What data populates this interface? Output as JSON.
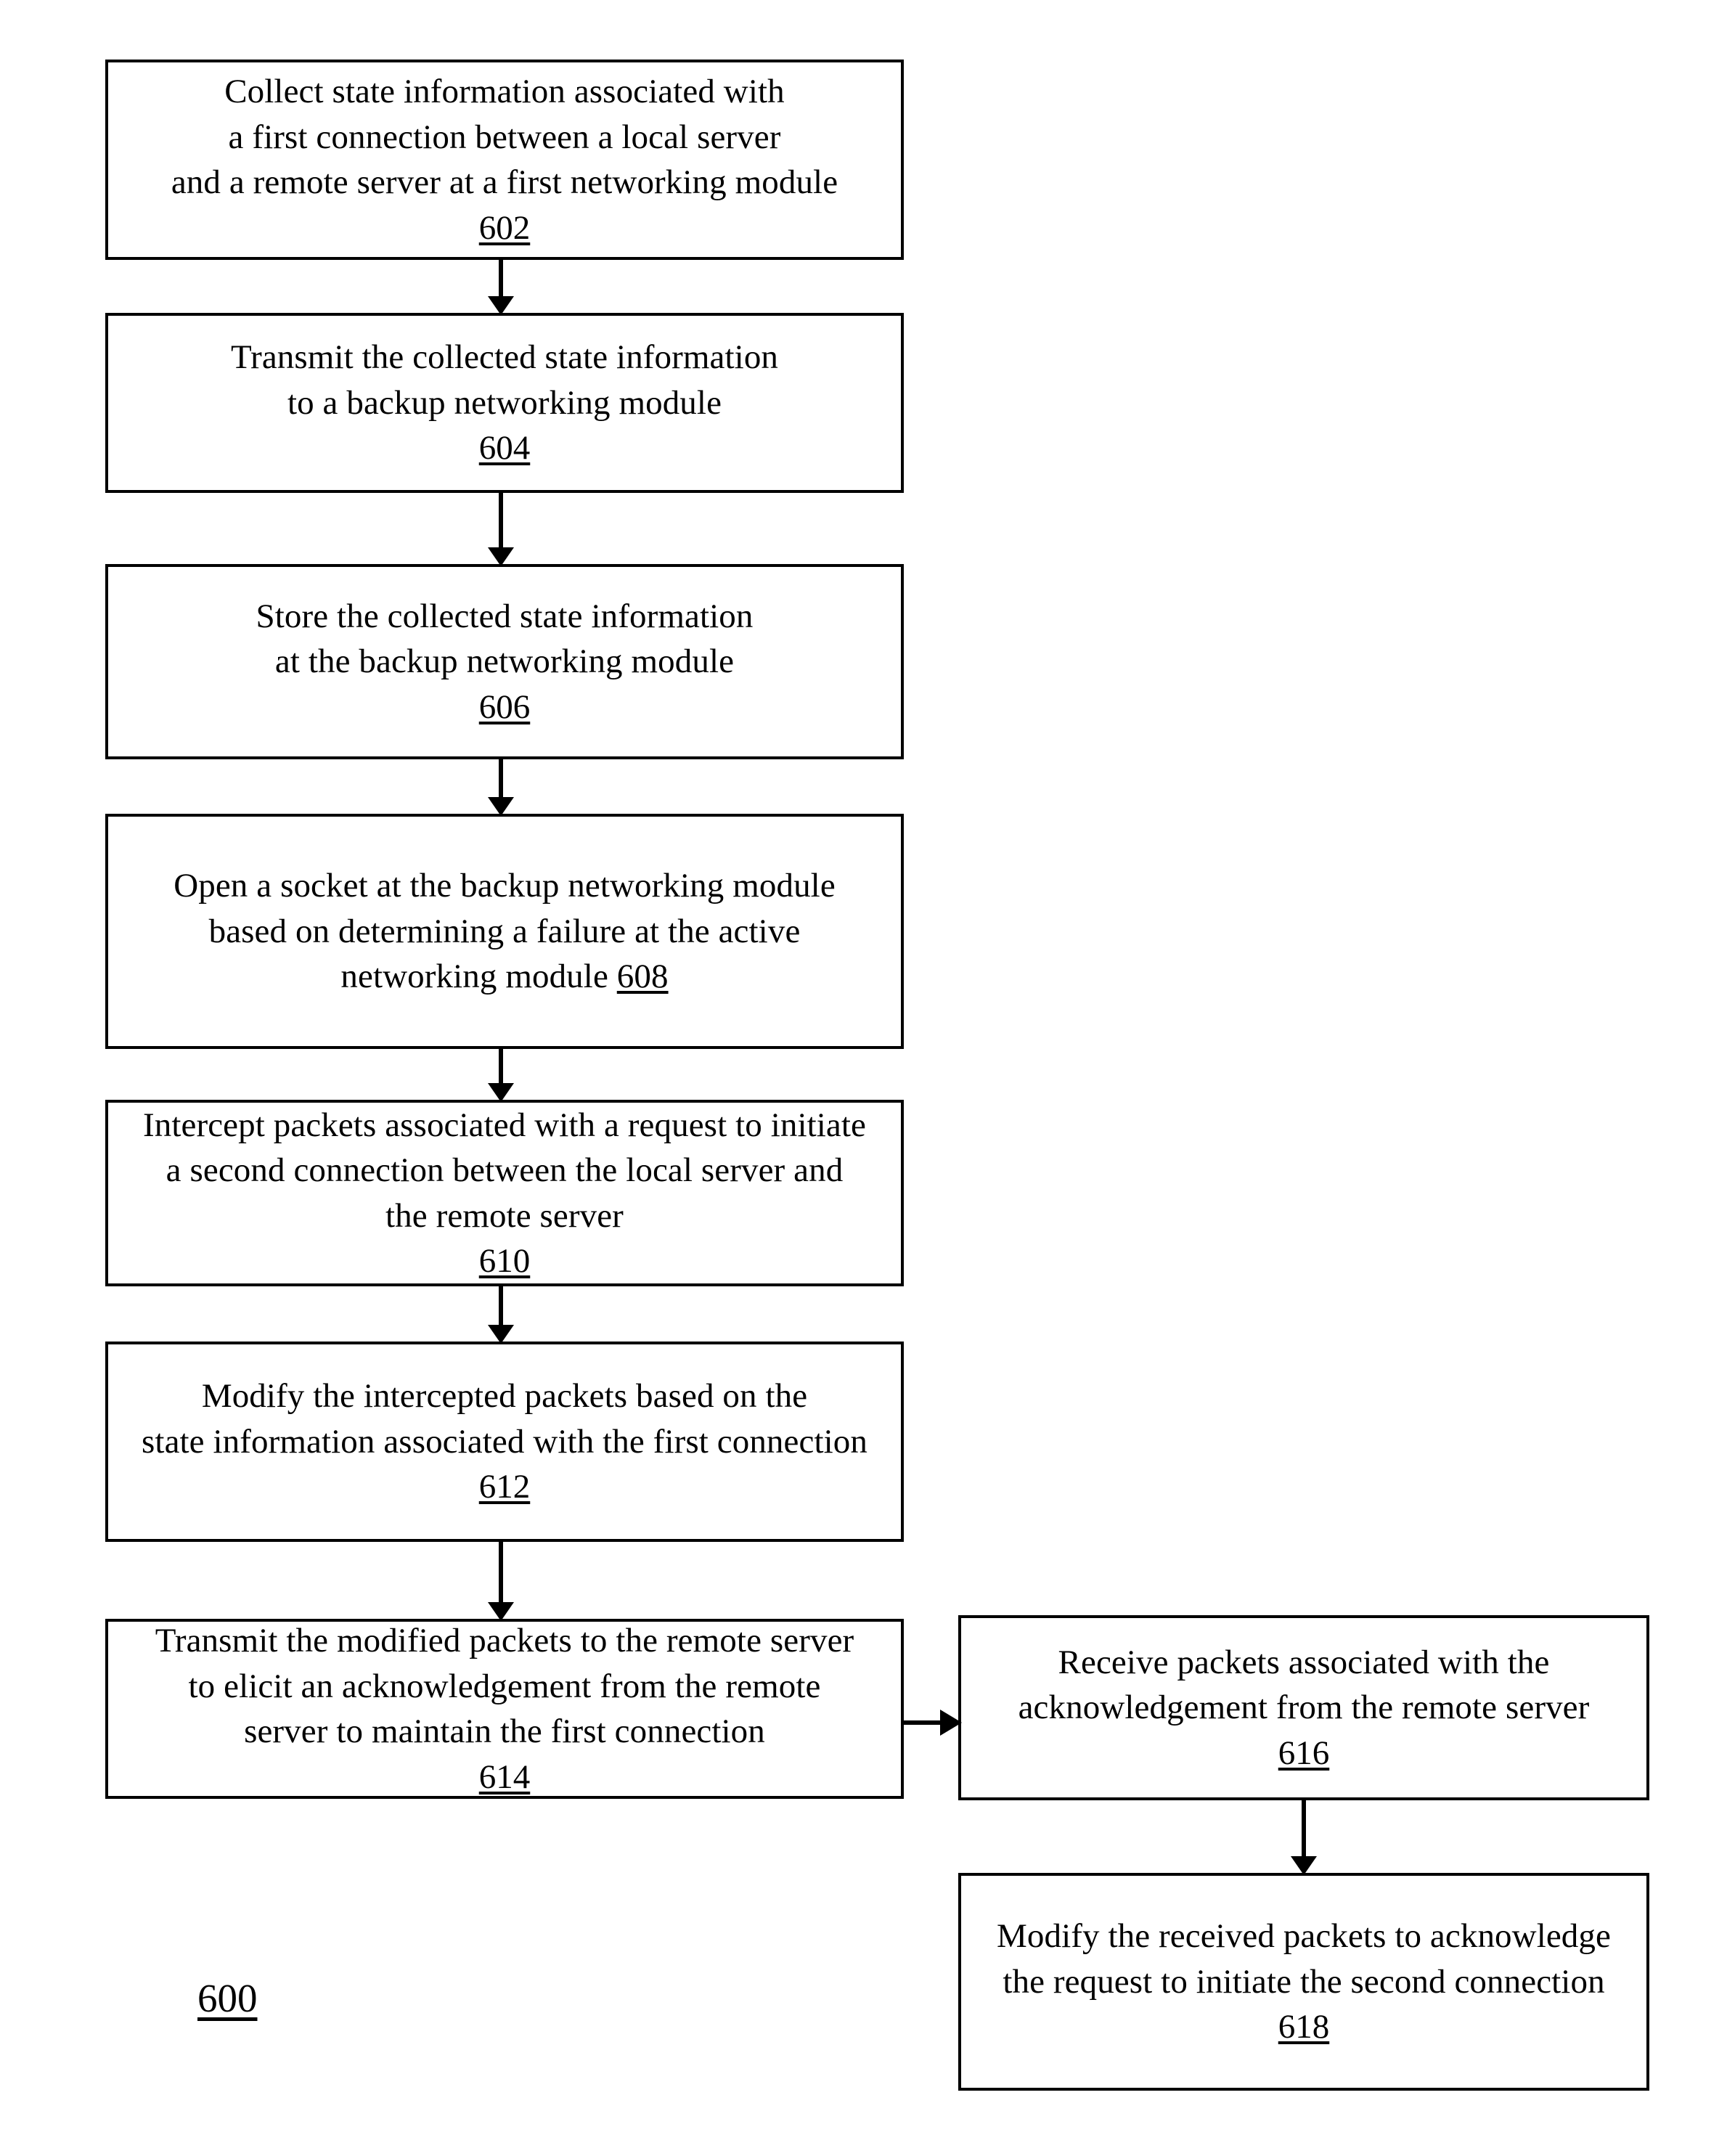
{
  "figure": {
    "label": "600"
  },
  "nodes": [
    {
      "id": "n602",
      "ref": "602",
      "ref_inline": false,
      "text": "Collect state information associated with\na first connection between a local server\nand a remote server at a first networking module"
    },
    {
      "id": "n604",
      "ref": "604",
      "ref_inline": false,
      "text": "Transmit the collected state information\nto a backup networking module"
    },
    {
      "id": "n606",
      "ref": "606",
      "ref_inline": false,
      "text": "Store the collected state information\nat the backup networking module"
    },
    {
      "id": "n608",
      "ref": "608",
      "ref_inline": true,
      "text": "Open a socket at the backup networking module\nbased on determining a failure at the active\nnetworking module "
    },
    {
      "id": "n610",
      "ref": "610",
      "ref_inline": false,
      "text": "Intercept packets associated with a request to initiate\na second connection between the local server and\nthe remote server"
    },
    {
      "id": "n612",
      "ref": "612",
      "ref_inline": false,
      "text": "Modify the intercepted packets based on the\nstate information associated with the first connection"
    },
    {
      "id": "n614",
      "ref": "614",
      "ref_inline": false,
      "text": "Transmit the modified packets to the remote server\nto elicit an acknowledgement from the remote\nserver to maintain the first connection"
    },
    {
      "id": "n616",
      "ref": "616",
      "ref_inline": false,
      "text": "Receive packets associated with the\nacknowledgement from the remote server"
    },
    {
      "id": "n618",
      "ref": "618",
      "ref_inline": false,
      "text": "Modify the received packets to acknowledge\nthe request to initiate the second connection"
    }
  ],
  "connectors": [
    {
      "id": "c602-604",
      "from": "602",
      "to": "604",
      "direction": "down"
    },
    {
      "id": "c604-606",
      "from": "604",
      "to": "606",
      "direction": "down"
    },
    {
      "id": "c606-608",
      "from": "606",
      "to": "608",
      "direction": "down"
    },
    {
      "id": "c608-610",
      "from": "608",
      "to": "610",
      "direction": "down"
    },
    {
      "id": "c610-612",
      "from": "610",
      "to": "612",
      "direction": "down"
    },
    {
      "id": "c612-614",
      "from": "612",
      "to": "614",
      "direction": "down"
    },
    {
      "id": "c614-616",
      "from": "614",
      "to": "616",
      "direction": "right"
    },
    {
      "id": "c616-618",
      "from": "616",
      "to": "618",
      "direction": "down"
    }
  ],
  "colors": {
    "stroke": "#000000",
    "background": "#ffffff",
    "text": "#000000"
  }
}
